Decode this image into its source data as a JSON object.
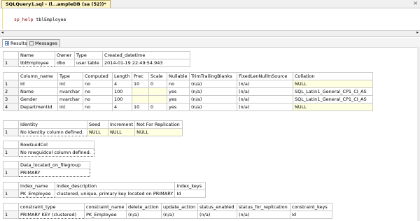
{
  "document_tab": {
    "title": "SQLQuery1.sql - (l...ampleDB (sa (52))*",
    "close": "×"
  },
  "editor": {
    "keyword": "sp_help",
    "argument": " tblEmployee"
  },
  "scroll": {
    "left": "◂",
    "right": "▸"
  },
  "results_tabs": [
    {
      "label": "Results"
    },
    {
      "label": "Messages"
    }
  ],
  "grids": {
    "g1": {
      "headers": [
        "",
        "Name",
        "Owner",
        "Type",
        "Created_datetime"
      ],
      "rows": [
        [
          "1",
          "tblEmployee",
          "dbo",
          "user table",
          "2014-01-19 22:49:54.943"
        ]
      ]
    },
    "g2": {
      "headers": [
        "",
        "Column_name",
        "Type",
        "Computed",
        "Length",
        "Prec",
        "Scale",
        "Nullable",
        "TrimTrailingBlanks",
        "FixedLenNullInSource",
        "Collation"
      ],
      "rows": [
        [
          "1",
          "Id",
          "int",
          "no",
          "4",
          "10",
          "0",
          "no",
          "(n/a)",
          "(n/a)",
          "NULL"
        ],
        [
          "2",
          "Name",
          "nvarchar",
          "no",
          "100",
          "",
          "",
          "yes",
          "(n/a)",
          "(n/a)",
          "SQL_Latin1_General_CP1_CI_AS"
        ],
        [
          "3",
          "Gender",
          "nvarchar",
          "no",
          "100",
          "",
          "",
          "yes",
          "(n/a)",
          "(n/a)",
          "SQL_Latin1_General_CP1_CI_AS"
        ],
        [
          "4",
          "DepartmentId",
          "int",
          "no",
          "4",
          "10",
          "0",
          "yes",
          "(n/a)",
          "(n/a)",
          "NULL"
        ]
      ]
    },
    "g3": {
      "headers": [
        "",
        "Identity",
        "Seed",
        "Increment",
        "Not For Replication"
      ],
      "rows": [
        [
          "1",
          "No identity column defined.",
          "NULL",
          "NULL",
          "NULL"
        ]
      ]
    },
    "g4": {
      "headers": [
        "",
        "RowGuidCol"
      ],
      "rows": [
        [
          "1",
          "No rowguidcol column defined."
        ]
      ]
    },
    "g5": {
      "headers": [
        "",
        "Data_located_on_filegroup"
      ],
      "rows": [
        [
          "1",
          "PRIMARY"
        ]
      ]
    },
    "g6": {
      "headers": [
        "",
        "index_name",
        "index_description",
        "index_keys"
      ],
      "rows": [
        [
          "1",
          "PK_Employee",
          "clustered, unique, primary key located on PRIMARY",
          "Id"
        ]
      ]
    },
    "g7": {
      "headers": [
        "",
        "constraint_type",
        "constraint_name",
        "delete_action",
        "update_action",
        "status_enabled",
        "status_for_replication",
        "constraint_keys"
      ],
      "rows": [
        [
          "1",
          "PRIMARY KEY (clustered)",
          "PK_Employee",
          "(n/a)",
          "(n/a)",
          "(n/a)",
          "(n/a)",
          "Id"
        ]
      ]
    }
  },
  "colors": {
    "null_cell": "#ffffe1",
    "tab_active": "#fff6c8",
    "keyword": "#8b0000"
  }
}
